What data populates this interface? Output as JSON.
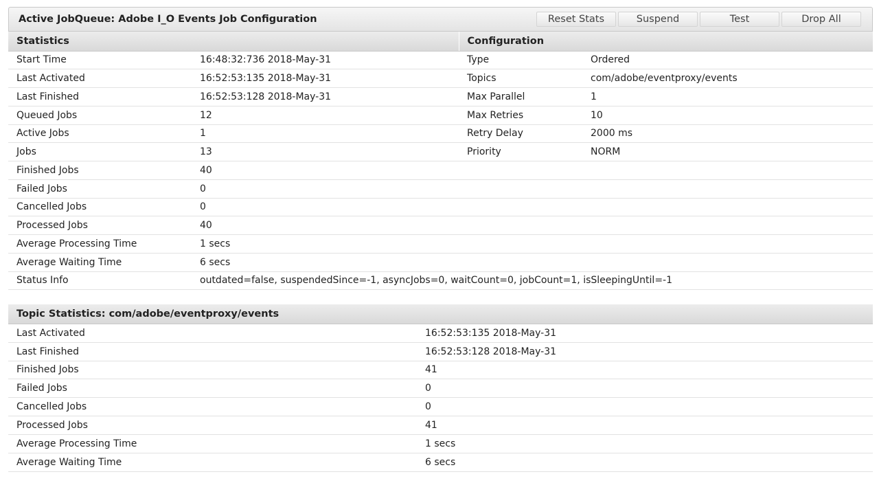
{
  "header": {
    "title": "Active JobQueue: Adobe I_O Events Job Configuration",
    "buttons": [
      "Reset Stats",
      "Suspend",
      "Test",
      "Drop All"
    ]
  },
  "statistics": {
    "heading": "Statistics",
    "rows": [
      [
        "Start Time",
        "16:48:32:736 2018-May-31"
      ],
      [
        "Last Activated",
        "16:52:53:135 2018-May-31"
      ],
      [
        "Last Finished",
        "16:52:53:128 2018-May-31"
      ],
      [
        "Queued Jobs",
        "12"
      ],
      [
        "Active Jobs",
        "1"
      ],
      [
        "Jobs",
        "13"
      ],
      [
        "Finished Jobs",
        "40"
      ],
      [
        "Failed Jobs",
        "0"
      ],
      [
        "Cancelled Jobs",
        "0"
      ],
      [
        "Processed Jobs",
        "40"
      ],
      [
        "Average Processing Time",
        "1 secs"
      ],
      [
        "Average Waiting Time",
        "6 secs"
      ],
      [
        "Status Info",
        "outdated=false, suspendedSince=-1, asyncJobs=0, waitCount=0, jobCount=1, isSleepingUntil=-1"
      ]
    ]
  },
  "configuration": {
    "heading": "Configuration",
    "rows": [
      [
        "Type",
        "Ordered"
      ],
      [
        "Topics",
        "com/adobe/eventproxy/events"
      ],
      [
        "Max Parallel",
        "1"
      ],
      [
        "Max Retries",
        "10"
      ],
      [
        "Retry Delay",
        "2000 ms"
      ],
      [
        "Priority",
        "NORM"
      ]
    ]
  },
  "topic_statistics": {
    "heading": "Topic Statistics: com/adobe/eventproxy/events",
    "rows": [
      [
        "Last Activated",
        "16:52:53:135 2018-May-31"
      ],
      [
        "Last Finished",
        "16:52:53:128 2018-May-31"
      ],
      [
        "Finished Jobs",
        "41"
      ],
      [
        "Failed Jobs",
        "0"
      ],
      [
        "Cancelled Jobs",
        "0"
      ],
      [
        "Processed Jobs",
        "41"
      ],
      [
        "Average Processing Time",
        "1 secs"
      ],
      [
        "Average Waiting Time",
        "6 secs"
      ]
    ]
  }
}
